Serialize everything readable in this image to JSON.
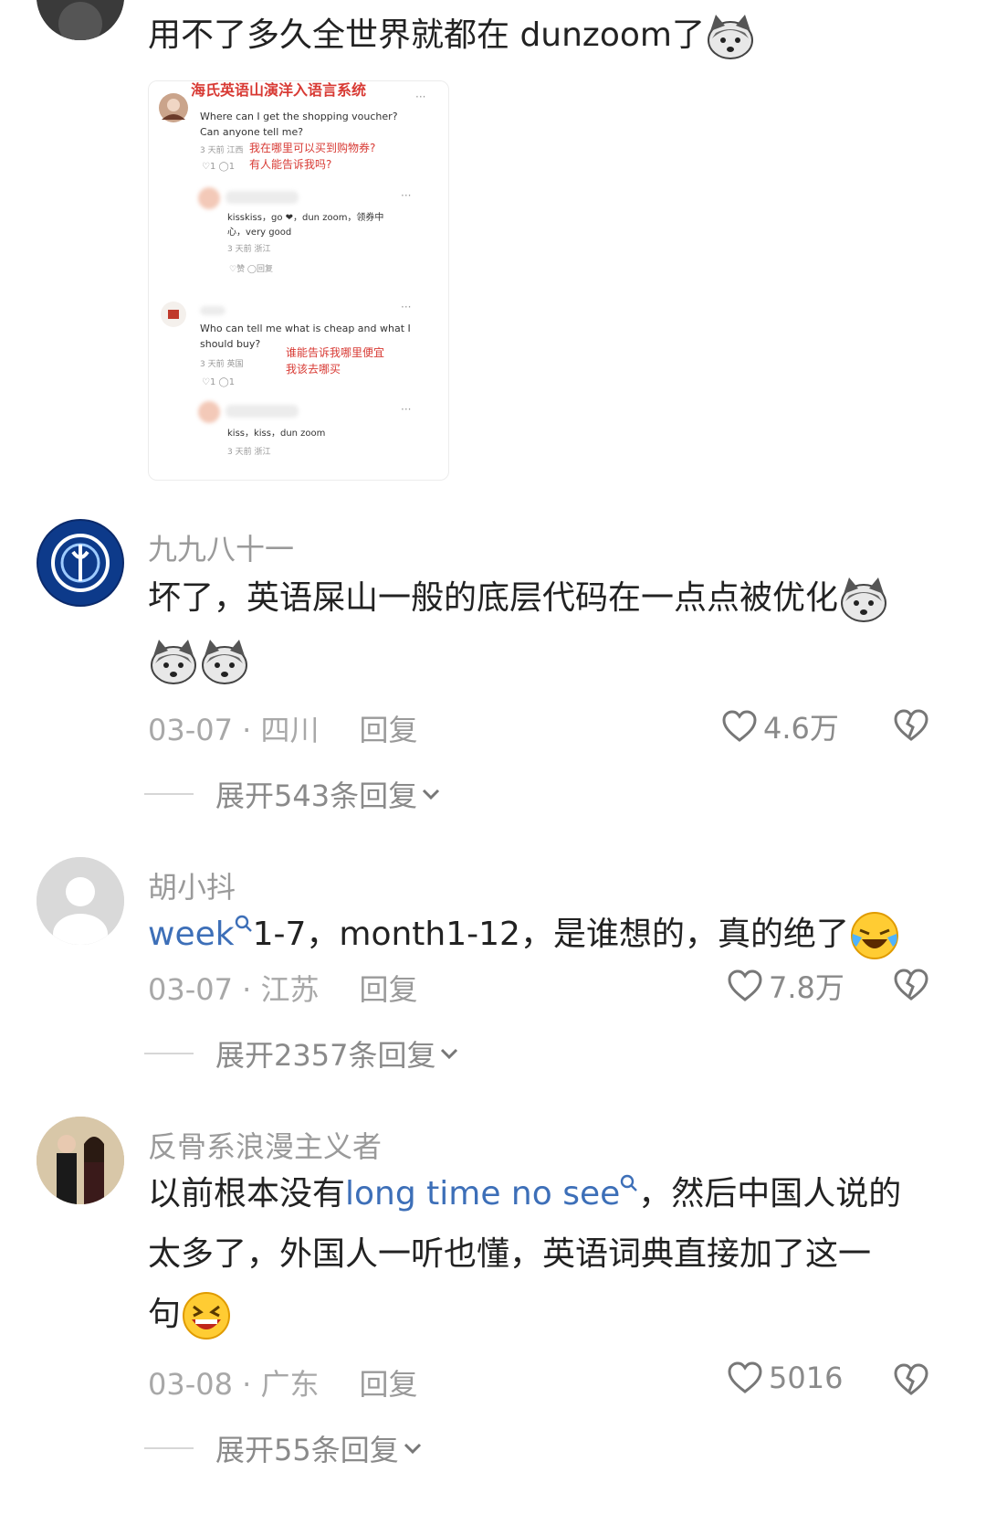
{
  "comments": [
    {
      "text": "用不了多久全世界就都在 dunzoom了",
      "embedded": {
        "header": "海氏英语山演洋入语言系统",
        "post1_en": "Where can I get the shopping voucher?",
        "post1_en2": "Can anyone tell me?",
        "post1_meta": "3 天前 江西",
        "post1_cn1": "我在哪里可以买到购物券?",
        "post1_cn2": "有人能告诉我吗?",
        "post1_stats": "♡1  ◯1",
        "reply1_text": "kisskiss，go ❤，dun zoom，领券中",
        "reply1_text2": "心，very good",
        "reply1_meta": "3 天前 浙江",
        "reply1_actions": "♡赞   ◯回复",
        "post2_en": "Who can tell me what is cheap and what I",
        "post2_en2": "should buy?",
        "post2_meta": "3 天前 英国",
        "post2_cn1": "谁能告诉我哪里便宜",
        "post2_cn2": "我该去哪买",
        "post2_stats": "♡1  ◯1",
        "reply2_text": "kiss，kiss，dun zoom",
        "reply2_meta": "3 天前 浙江",
        "more": "···"
      }
    },
    {
      "username": "九九八十一",
      "text_line1": "坏了，英语屎山一般的底层代码在一点点被优化",
      "date": "03-07",
      "location": "四川",
      "reply": "回复",
      "likes": "4.6万",
      "expand": "展开543条回复"
    },
    {
      "username": "胡小抖",
      "text_link": "week",
      "text_rest": "1-7，month1-12，是谁想的，真的绝了",
      "date": "03-07",
      "location": "江苏",
      "reply": "回复",
      "likes": "7.8万",
      "expand": "展开2357条回复"
    },
    {
      "username": "反骨系浪漫主义者",
      "text_pre": "以前根本没有",
      "text_link": "long time no see",
      "text_post": "，然后中国人说的",
      "text_line2": "太多了，外国人一听也懂，英语词典直接加了这一",
      "text_line3": "句",
      "date": "03-08",
      "location": "广东",
      "reply": "回复",
      "likes": "5016",
      "expand": "展开55条回复"
    }
  ],
  "colors": {
    "link": "#3d6fb8",
    "muted": "#a8a8a8",
    "red": "#d83a34"
  },
  "icons": [
    "husky-emoji",
    "laugh-cry-emoji",
    "grin-emoji",
    "heart-icon",
    "broken-heart-icon",
    "chevron-down-icon",
    "search-icon"
  ]
}
